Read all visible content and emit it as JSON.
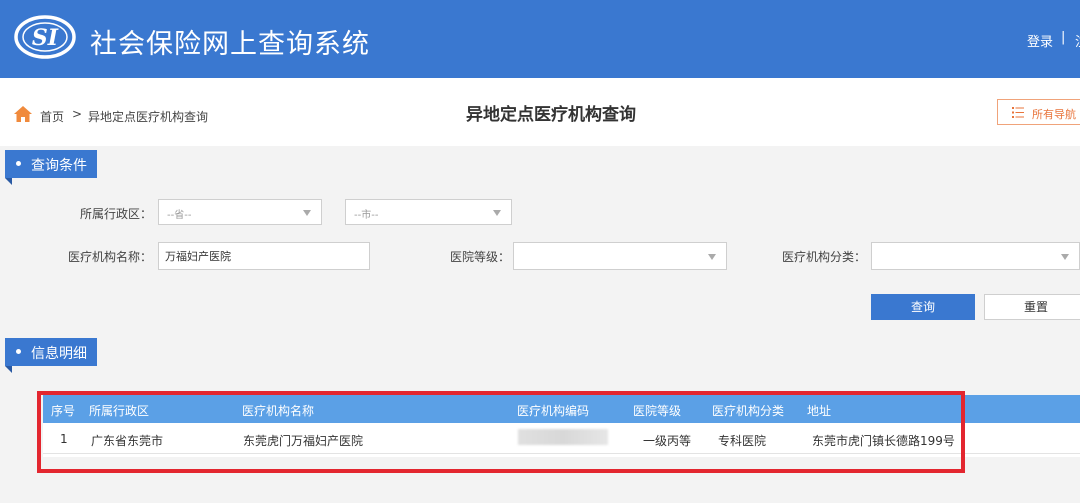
{
  "header": {
    "logo_text": "SI",
    "app_title": "社会保险网上查询系统",
    "login_label": "登录",
    "separator": "|",
    "cut_label": "注"
  },
  "breadcrumb": {
    "home_label": "首页",
    "separator": ">",
    "current_label": "异地定点医疗机构查询"
  },
  "page_title": "异地定点医疗机构查询",
  "nav_button": {
    "label": "所有导航"
  },
  "query_section": {
    "title": "查询条件",
    "region_label": "所属行政区：",
    "province_placeholder": "--省--",
    "city_placeholder": "--市--",
    "institution_name_label": "医疗机构名称：",
    "institution_name_value": "万福妇产医院",
    "hospital_level_label": "医院等级：",
    "hospital_level_value": "",
    "institution_category_label": "医疗机构分类：",
    "institution_category_value": "",
    "query_button": "查询",
    "reset_button": "重置"
  },
  "result_section": {
    "title": "信息明细",
    "columns": [
      "序号",
      "所属行政区",
      "医疗机构名称",
      "医疗机构编码",
      "医院等级",
      "医疗机构分类",
      "地址"
    ],
    "rows": [
      {
        "index": "1",
        "region": "广东省东莞市",
        "name": "东莞虎门万福妇产医院",
        "code": "",
        "level": "一级丙等",
        "category": "专科医院",
        "address": "东莞市虎门镇长德路199号"
      }
    ]
  },
  "colors": {
    "header_bg": "#3a78d0",
    "table_header_bg": "#5ba0e6",
    "highlight_red": "#e3262f",
    "nav_orange": "#e8743b"
  }
}
